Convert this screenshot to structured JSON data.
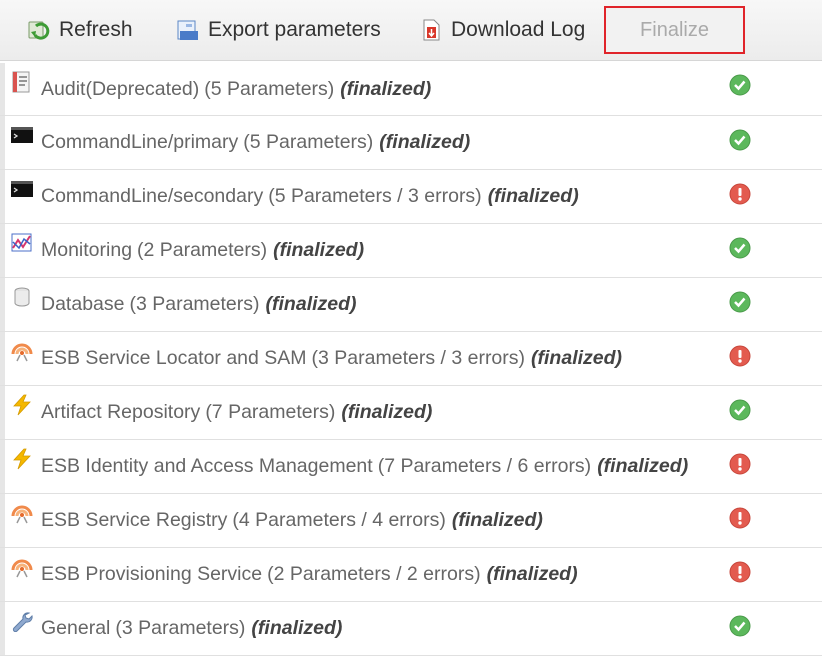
{
  "toolbar": {
    "refresh_label": "Refresh",
    "export_label": "Export parameters",
    "download_label": "Download Log",
    "finalize_label": "Finalize"
  },
  "colors": {
    "ok_green": "#5cb85c",
    "error_red": "#e35b4f",
    "highlight_border": "#e0242a"
  },
  "rows": [
    {
      "name": "Audit(Deprecated)",
      "detail": "(5 Parameters)",
      "status_text": "(finalized)",
      "icon": "audit-doc-icon",
      "status": "ok"
    },
    {
      "name": "CommandLine/primary",
      "detail": "(5 Parameters)",
      "status_text": "(finalized)",
      "icon": "terminal-icon",
      "status": "ok"
    },
    {
      "name": "CommandLine/secondary",
      "detail": "(5 Parameters / 3 errors)",
      "status_text": "(finalized)",
      "icon": "terminal-icon",
      "status": "error"
    },
    {
      "name": "Monitoring",
      "detail": "(2 Parameters)",
      "status_text": "(finalized)",
      "icon": "monitoring-chart-icon",
      "status": "ok"
    },
    {
      "name": "Database",
      "detail": "(3 Parameters)",
      "status_text": "(finalized)",
      "icon": "database-icon",
      "status": "ok"
    },
    {
      "name": "ESB Service Locator and SAM",
      "detail": "(3 Parameters / 3 errors)",
      "status_text": "(finalized)",
      "icon": "service-broadcast-icon",
      "status": "error"
    },
    {
      "name": "Artifact Repository",
      "detail": "(7 Parameters)",
      "status_text": "(finalized)",
      "icon": "lightning-icon",
      "status": "ok"
    },
    {
      "name": "ESB Identity and Access Management",
      "detail": "(7 Parameters / 6 errors)",
      "status_text": "(finalized)",
      "icon": "lightning-icon",
      "status": "error"
    },
    {
      "name": "ESB Service Registry",
      "detail": "(4 Parameters / 4 errors)",
      "status_text": "(finalized)",
      "icon": "service-broadcast-icon",
      "status": "error"
    },
    {
      "name": "ESB Provisioning Service",
      "detail": "(2 Parameters / 2 errors)",
      "status_text": "(finalized)",
      "icon": "service-broadcast-icon",
      "status": "error"
    },
    {
      "name": "General",
      "detail": "(3 Parameters)",
      "status_text": "(finalized)",
      "icon": "wrench-icon",
      "status": "ok"
    }
  ]
}
